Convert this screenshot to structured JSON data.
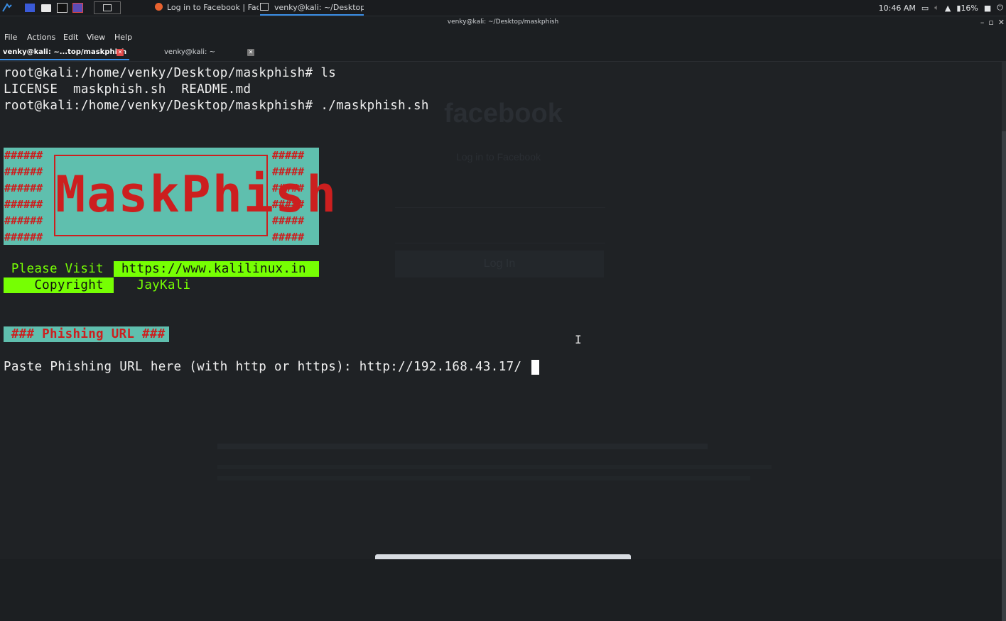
{
  "panel": {
    "tasks": [
      {
        "label": "Log in to Facebook | Fac..."
      },
      {
        "label": "venky@kali: ~/Desktop/..."
      }
    ],
    "tray": {
      "time": "10:46 AM",
      "battery": "16%"
    }
  },
  "window": {
    "title": "venky@kali: ~/Desktop/maskphish",
    "controls": {
      "minimize": "–",
      "maximize": "▫",
      "close": "✕"
    }
  },
  "menubar": {
    "items": [
      "File",
      "Actions",
      "Edit",
      "View",
      "Help"
    ]
  },
  "tabs": [
    {
      "label": "venky@kali: ~...top/maskphish",
      "active": true
    },
    {
      "label": "venky@kali: ~",
      "active": false
    }
  ],
  "terminal": {
    "lines": [
      "root@kali:/home/venky/Desktop/maskphish# ls",
      "LICENSE  maskphish.sh  README.md",
      "root@kali:/home/venky/Desktop/maskphish# ./maskphish.sh"
    ],
    "banner": {
      "title": "MaskPhish",
      "hash_left": "######\n######\n######\n######\n######\n######",
      "hash_right": "#####\n#####\n#####\n#####\n#####\n#####"
    },
    "visit_label": " Please Visit ",
    "visit_url": " https://www.kalilinux.in ",
    "copyright_label": "    Copyright ",
    "copyright_value": "   JayKali ",
    "phishing_header": " ### Phishing URL ###",
    "prompt": "Paste Phishing URL here (with http or https): http://192.168.43.17/"
  },
  "ghost": {
    "brand": "facebook",
    "heading": "Log in to Facebook",
    "login_button": "Log In"
  },
  "colors": {
    "banner_bg": "#5fbfae",
    "banner_fg": "#cc1f1f",
    "green_bg": "#76ff03",
    "accent": "#3a8ee6"
  }
}
